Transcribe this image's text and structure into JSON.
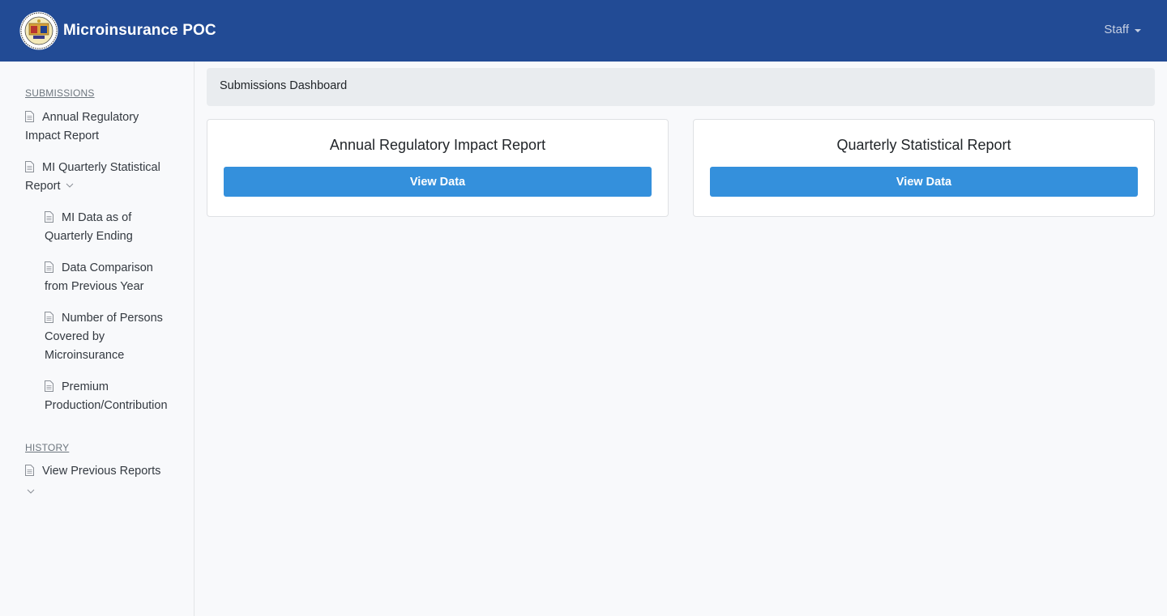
{
  "header": {
    "brand": "Microinsurance POC",
    "user_menu": "Staff"
  },
  "sidebar": {
    "submissions_title": "SUBMISSIONS",
    "annual_report": "Annual Regulatory Impact Report",
    "quarterly_report": "MI Quarterly Statistical Report",
    "quarterly_sub": [
      "MI Data as of Quarterly Ending",
      "Data Comparison from Previous Year",
      "Number of Persons Covered by Microinsurance",
      "Premium Production/Contribution"
    ],
    "history_title": "HISTORY",
    "previous_reports": "View Previous Reports"
  },
  "breadcrumb": "Submissions Dashboard",
  "cards": [
    {
      "title": "Annual Regulatory Impact Report",
      "button": "View Data"
    },
    {
      "title": "Quarterly Statistical Report",
      "button": "View Data"
    }
  ],
  "colors": {
    "navbar": "#224b95",
    "button": "#3490dc"
  }
}
